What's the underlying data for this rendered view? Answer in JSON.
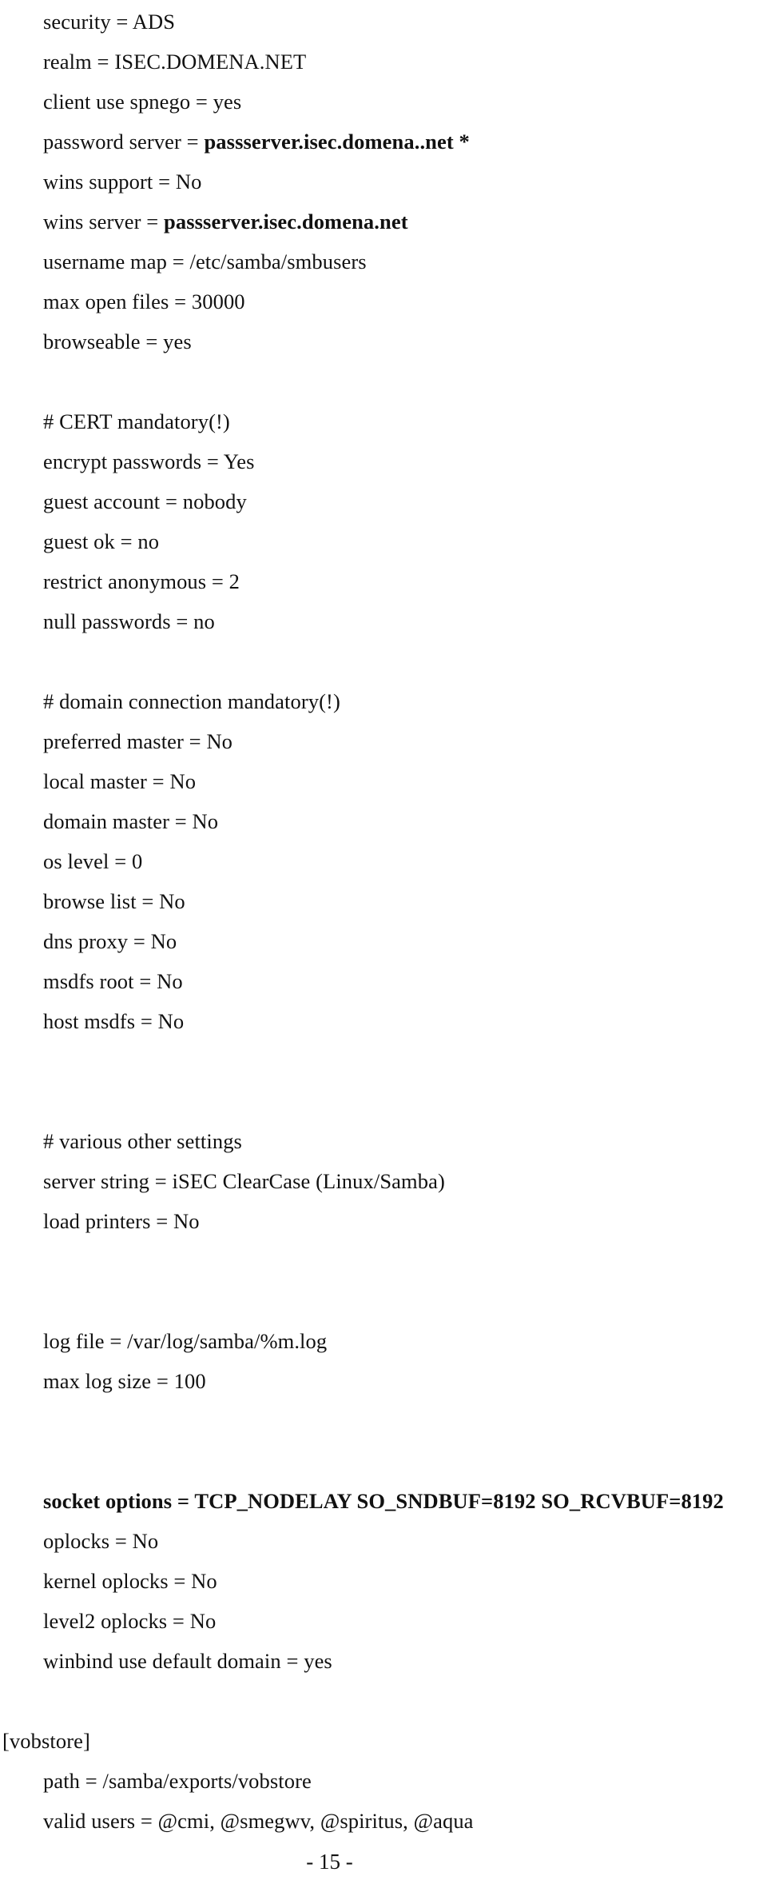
{
  "document": {
    "type": "samba-configuration-listing",
    "page_number_label": "- 15 -"
  },
  "listing": {
    "lines": [
      {
        "id": "l01",
        "text": "security = ADS",
        "indent": "normal",
        "bold": ""
      },
      {
        "id": "l02",
        "text": "realm = ISEC.DOMENA.NET",
        "indent": "normal",
        "bold": ""
      },
      {
        "id": "l03",
        "text": "client use spnego = yes",
        "indent": "normal",
        "bold": ""
      },
      {
        "id": "l04",
        "text": "password server = ",
        "indent": "normal",
        "bold": "passserver.isec.domena..net *"
      },
      {
        "id": "l05",
        "text": "wins support = No",
        "indent": "normal",
        "bold": ""
      },
      {
        "id": "l06",
        "text": "wins server = ",
        "indent": "normal",
        "bold": "passserver.isec.domena.net"
      },
      {
        "id": "l07",
        "text": "username map = /etc/samba/smbusers",
        "indent": "normal",
        "bold": ""
      },
      {
        "id": "l08",
        "text": "max open files = 30000",
        "indent": "normal",
        "bold": ""
      },
      {
        "id": "l09",
        "text": "browseable = yes",
        "indent": "normal",
        "bold": ""
      },
      {
        "id": "l10",
        "text": "",
        "indent": "normal",
        "bold": ""
      },
      {
        "id": "l11",
        "text": "# CERT mandatory(!)",
        "indent": "normal",
        "bold": ""
      },
      {
        "id": "l12",
        "text": "encrypt passwords = Yes",
        "indent": "normal",
        "bold": ""
      },
      {
        "id": "l13",
        "text": "guest account = nobody",
        "indent": "normal",
        "bold": ""
      },
      {
        "id": "l14",
        "text": "guest ok = no",
        "indent": "normal",
        "bold": ""
      },
      {
        "id": "l15",
        "text": "restrict anonymous = 2",
        "indent": "normal",
        "bold": ""
      },
      {
        "id": "l16",
        "text": "null passwords = no",
        "indent": "normal",
        "bold": ""
      },
      {
        "id": "l17",
        "text": "",
        "indent": "normal",
        "bold": ""
      },
      {
        "id": "l18",
        "text": "# domain connection mandatory(!)",
        "indent": "normal",
        "bold": ""
      },
      {
        "id": "l19",
        "text": "preferred master = No",
        "indent": "normal",
        "bold": ""
      },
      {
        "id": "l20",
        "text": "local master = No",
        "indent": "normal",
        "bold": ""
      },
      {
        "id": "l21",
        "text": "domain master = No",
        "indent": "normal",
        "bold": ""
      },
      {
        "id": "l22",
        "text": "os level = 0",
        "indent": "normal",
        "bold": ""
      },
      {
        "id": "l23",
        "text": "browse list = No",
        "indent": "normal",
        "bold": ""
      },
      {
        "id": "l24",
        "text": "dns proxy = No",
        "indent": "normal",
        "bold": ""
      },
      {
        "id": "l25",
        "text": "msdfs root = No",
        "indent": "normal",
        "bold": ""
      },
      {
        "id": "l26",
        "text": "host msdfs = No",
        "indent": "normal",
        "bold": ""
      },
      {
        "id": "l27",
        "text": "",
        "indent": "normal",
        "bold": ""
      },
      {
        "id": "l28",
        "text": "",
        "indent": "normal",
        "bold": ""
      },
      {
        "id": "l29",
        "text": "# various other settings",
        "indent": "normal",
        "bold": ""
      },
      {
        "id": "l30",
        "text": "server string = iSEC ClearCase (Linux/Samba)",
        "indent": "normal",
        "bold": ""
      },
      {
        "id": "l31",
        "text": "load printers = No",
        "indent": "normal",
        "bold": ""
      },
      {
        "id": "l32",
        "text": "",
        "indent": "normal",
        "bold": ""
      },
      {
        "id": "l33",
        "text": "",
        "indent": "normal",
        "bold": ""
      },
      {
        "id": "l34",
        "text": "log file = /var/log/samba/%m.log",
        "indent": "normal",
        "bold": ""
      },
      {
        "id": "l35",
        "text": "max log size = 100",
        "indent": "normal",
        "bold": ""
      },
      {
        "id": "l36",
        "text": "",
        "indent": "normal",
        "bold": ""
      },
      {
        "id": "l37",
        "text": "",
        "indent": "normal",
        "bold": ""
      },
      {
        "id": "l38",
        "text": "",
        "indent": "normal",
        "bold": "socket options = TCP_NODELAY SO_SNDBUF=8192 SO_RCVBUF=8192"
      },
      {
        "id": "l39",
        "text": "oplocks = No",
        "indent": "normal",
        "bold": ""
      },
      {
        "id": "l40",
        "text": "kernel oplocks = No",
        "indent": "normal",
        "bold": ""
      },
      {
        "id": "l41",
        "text": "level2 oplocks = No",
        "indent": "normal",
        "bold": ""
      },
      {
        "id": "l42",
        "text": "winbind use default domain = yes",
        "indent": "normal",
        "bold": ""
      },
      {
        "id": "l43",
        "text": "",
        "indent": "normal",
        "bold": ""
      },
      {
        "id": "l44",
        "text": "[vobstore]",
        "indent": "flush",
        "bold": ""
      },
      {
        "id": "l45",
        "text": "path = /samba/exports/vobstore",
        "indent": "normal",
        "bold": ""
      },
      {
        "id": "l46",
        "text": "valid users = @cmi, @smegwv, @spiritus, @aqua",
        "indent": "normal",
        "bold": ""
      }
    ]
  }
}
